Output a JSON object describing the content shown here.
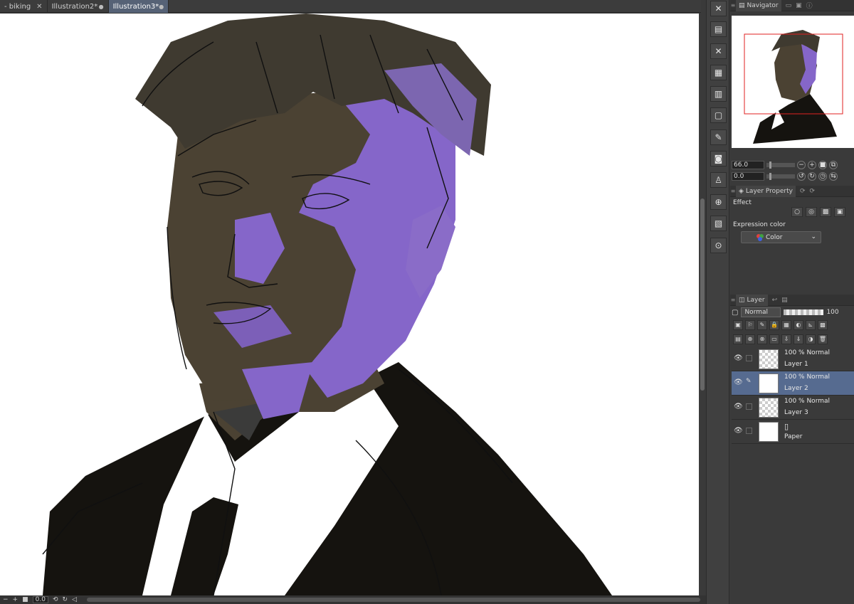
{
  "tabs": [
    {
      "label": "- biking",
      "close": "✕",
      "active": false
    },
    {
      "label": "Illustration2*",
      "close": "●",
      "active": false
    },
    {
      "label": "Illustration3*",
      "close": "●",
      "active": true
    }
  ],
  "navigator": {
    "tab_label": "Navigator"
  },
  "zoom": {
    "value": "66.0",
    "rotation": "0.0"
  },
  "layer_property": {
    "tab_label": "Layer Property",
    "effect_label": "Effect",
    "expression_color_label": "Expression color",
    "expression_color_value": "Color"
  },
  "layer_panel": {
    "tab_label": "Layer",
    "blend_mode": "Normal",
    "opacity": "100",
    "layers": [
      {
        "mode": "100 % Normal",
        "name": "Layer 1",
        "selected": false
      },
      {
        "mode": "100 % Normal",
        "name": "Layer 2",
        "selected": true
      },
      {
        "mode": "100 % Normal",
        "name": "Layer 3",
        "selected": false
      },
      {
        "mode": "",
        "name": "Paper",
        "selected": false
      }
    ]
  },
  "statusbar": {
    "zoom_value": "0.0"
  },
  "colors": {
    "accent": "#566276",
    "selected_layer": "#566b90",
    "panel_bg": "#3a3a3a"
  }
}
